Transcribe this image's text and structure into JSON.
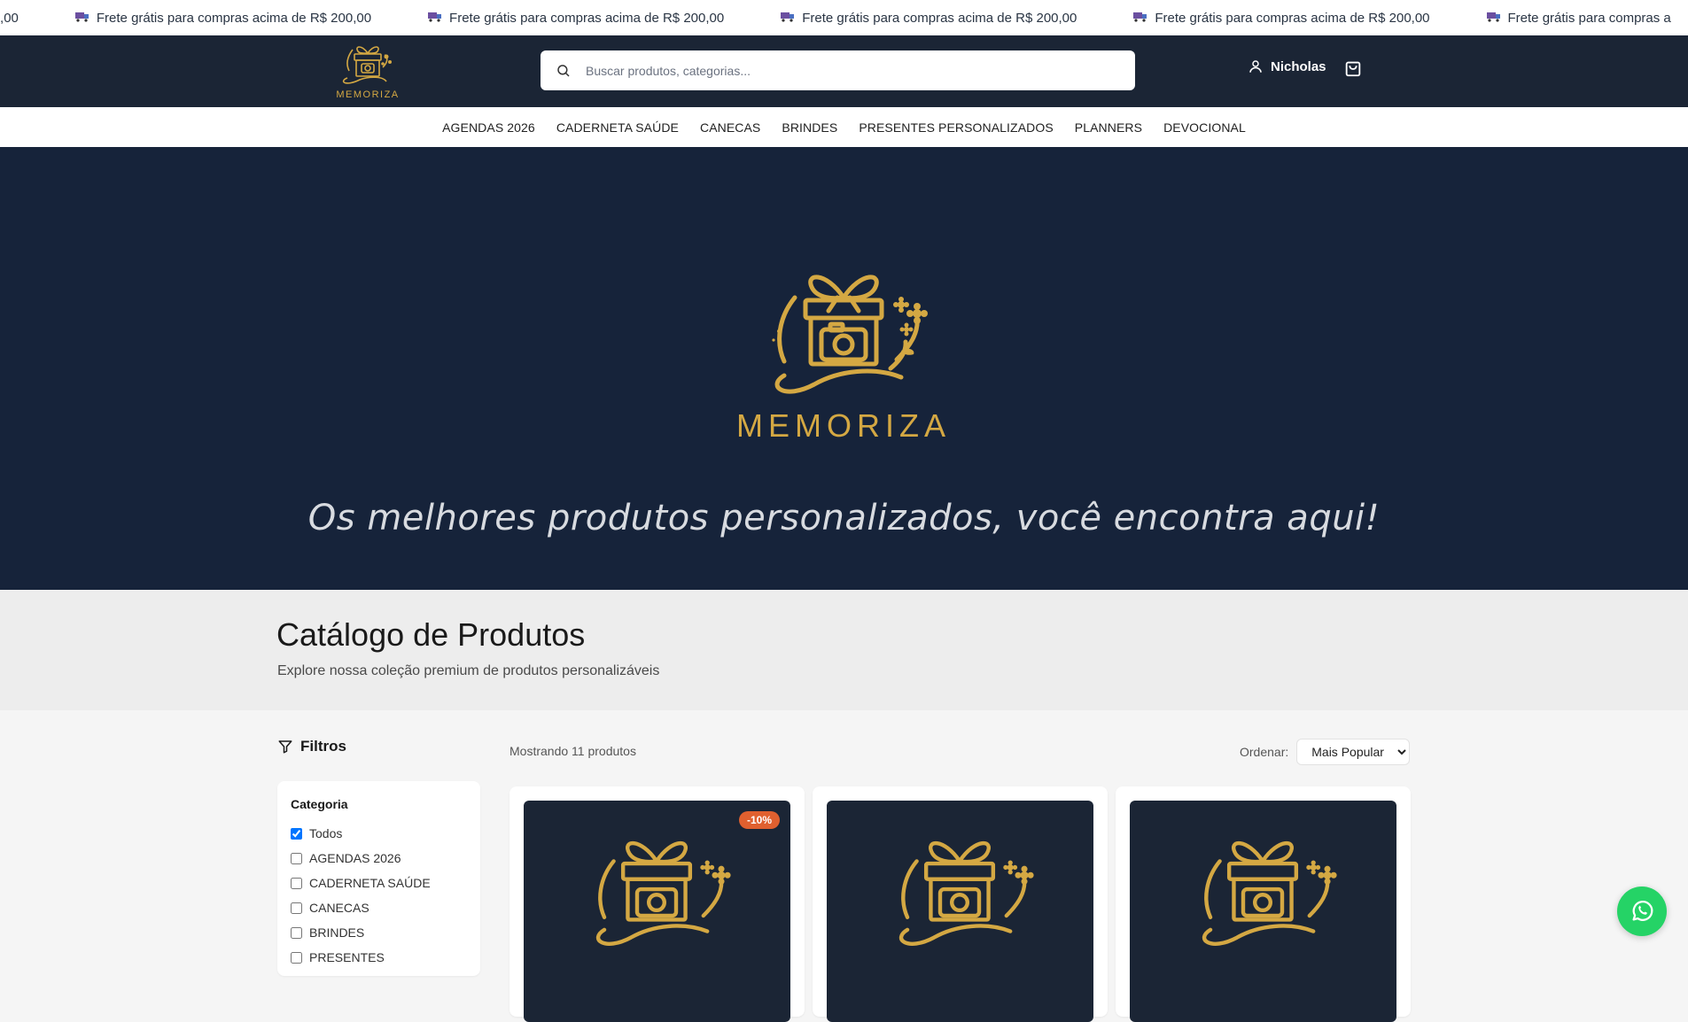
{
  "ticker": {
    "partial_text": "200,00",
    "items": [
      "Frete grátis para compras acima de R$ 200,00",
      "Frete grátis para compras acima de R$ 200,00",
      "Frete grátis para compras acima de R$ 200,00",
      "Frete grátis para compras acima de R$ 200,00",
      "Frete grátis para compras a"
    ],
    "icon": "truck-icon"
  },
  "header": {
    "brand": "MEMORIZA",
    "search_placeholder": "Buscar produtos, categorias...",
    "user_name": "Nicholas",
    "colors": {
      "bg": "#1b2535",
      "gold": "#d4a843"
    }
  },
  "nav": {
    "items": [
      "AGENDAS 2026",
      "CADERNETA SAÚDE",
      "CANECAS",
      "BRINDES",
      "PRESENTES PERSONALIZADOS",
      "PLANNERS",
      "DEVOCIONAL"
    ]
  },
  "hero": {
    "brand": "MEMORIZA",
    "tagline": "Os melhores produtos personalizados, você encontra aqui!"
  },
  "catalog": {
    "title": "Catálogo de Produtos",
    "subtitle": "Explore nossa coleção premium de produtos personalizáveis"
  },
  "filters": {
    "title": "Filtros",
    "category_title": "Categoria",
    "options": [
      {
        "label": "Todos",
        "checked": true
      },
      {
        "label": "AGENDAS 2026",
        "checked": false
      },
      {
        "label": "CADERNETA SAÚDE",
        "checked": false
      },
      {
        "label": "CANECAS",
        "checked": false
      },
      {
        "label": "BRINDES",
        "checked": false
      },
      {
        "label": "PRESENTES",
        "checked": false
      }
    ]
  },
  "products": {
    "count_label": "Mostrando 11 produtos",
    "sort_label": "Ordenar:",
    "sort_value": "Mais Popular",
    "cards": [
      {
        "badge": "-10%"
      },
      {
        "badge": ""
      },
      {
        "badge": ""
      }
    ]
  }
}
